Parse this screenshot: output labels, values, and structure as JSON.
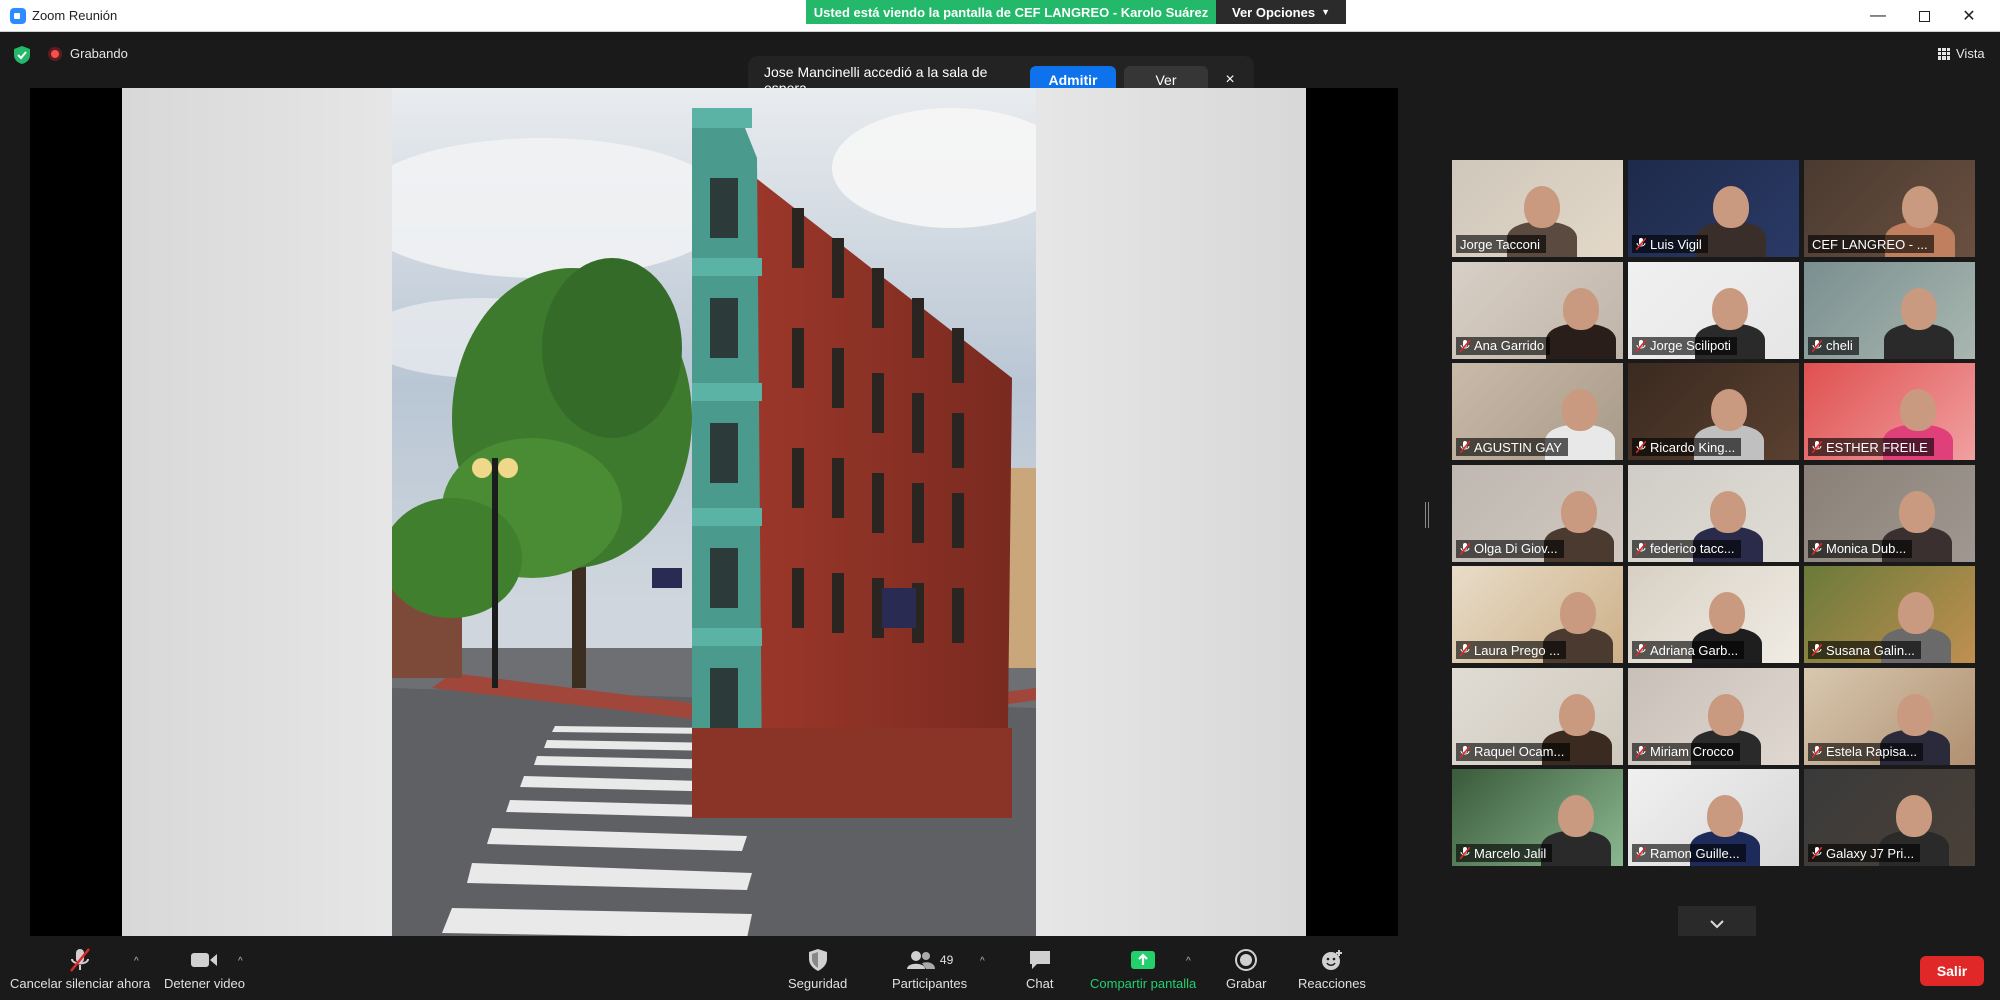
{
  "window": {
    "title": "Zoom Reunión",
    "minimize_icon": "minimize-icon",
    "maximize_icon": "maximize-icon",
    "close_icon": "close-icon"
  },
  "share_banner": {
    "text": "Usted está viendo la pantalla de CEF LANGREO - Karolo Suárez",
    "color": "#23b86a"
  },
  "view_options": {
    "label": "Ver Opciones",
    "icon": "chevron-down-icon"
  },
  "status": {
    "security_icon": "shield-check-icon",
    "recording_label": "Grabando",
    "recording_icon": "record-dot-icon"
  },
  "view": {
    "label": "Vista",
    "icon": "grid-icon"
  },
  "notification": {
    "message": "Jose Mancinelli accedió a la sala de espera",
    "admit_label": "Admitir",
    "view_label": "Ver",
    "close_label": "×",
    "admit_color": "#0e72ed"
  },
  "shared_content": {
    "description_icon": "photo-image"
  },
  "participants": [
    {
      "name": "Jorge Tacconi",
      "muted": false,
      "active": true
    },
    {
      "name": "Luis Vigil",
      "muted": true,
      "active": false
    },
    {
      "name": "CEF LANGREO - ...",
      "muted": false,
      "active": false
    },
    {
      "name": "Ana Garrido",
      "muted": true,
      "active": false
    },
    {
      "name": "Jorge Scilipoti",
      "muted": true,
      "active": false
    },
    {
      "name": "cheli",
      "muted": true,
      "active": false
    },
    {
      "name": "AGUSTIN GAY",
      "muted": true,
      "active": false
    },
    {
      "name": "Ricardo King...",
      "muted": true,
      "active": false
    },
    {
      "name": "ESTHER FREILE",
      "muted": true,
      "active": false
    },
    {
      "name": "Olga Di Giov...",
      "muted": true,
      "active": false
    },
    {
      "name": "federico tacc...",
      "muted": true,
      "active": false
    },
    {
      "name": "Monica Dub...",
      "muted": true,
      "active": false
    },
    {
      "name": "Laura Prego ...",
      "muted": true,
      "active": false
    },
    {
      "name": "Adriana Garb...",
      "muted": true,
      "active": false
    },
    {
      "name": "Susana Galin...",
      "muted": true,
      "active": false
    },
    {
      "name": "Raquel Ocam...",
      "muted": true,
      "active": false
    },
    {
      "name": "Miriam Crocco",
      "muted": true,
      "active": false
    },
    {
      "name": "Estela Rapisa...",
      "muted": true,
      "active": false
    },
    {
      "name": "Marcelo Jalil",
      "muted": true,
      "active": false
    },
    {
      "name": "Ramon Guille...",
      "muted": true,
      "active": false
    },
    {
      "name": "Galaxy J7 Pri...",
      "muted": true,
      "active": false
    }
  ],
  "gallery_scroll_icon": "chevron-down-icon",
  "toolbar": {
    "unmute_label": "Cancelar silenciar ahora",
    "video_label": "Detener video",
    "security_label": "Seguridad",
    "participants_label": "Participantes",
    "participants_count": "49",
    "chat_label": "Chat",
    "share_label": "Compartir pantalla",
    "record_label": "Grabar",
    "reactions_label": "Reacciones",
    "leave_label": "Salir",
    "share_color": "#23d06d",
    "leave_color": "#e02828"
  }
}
